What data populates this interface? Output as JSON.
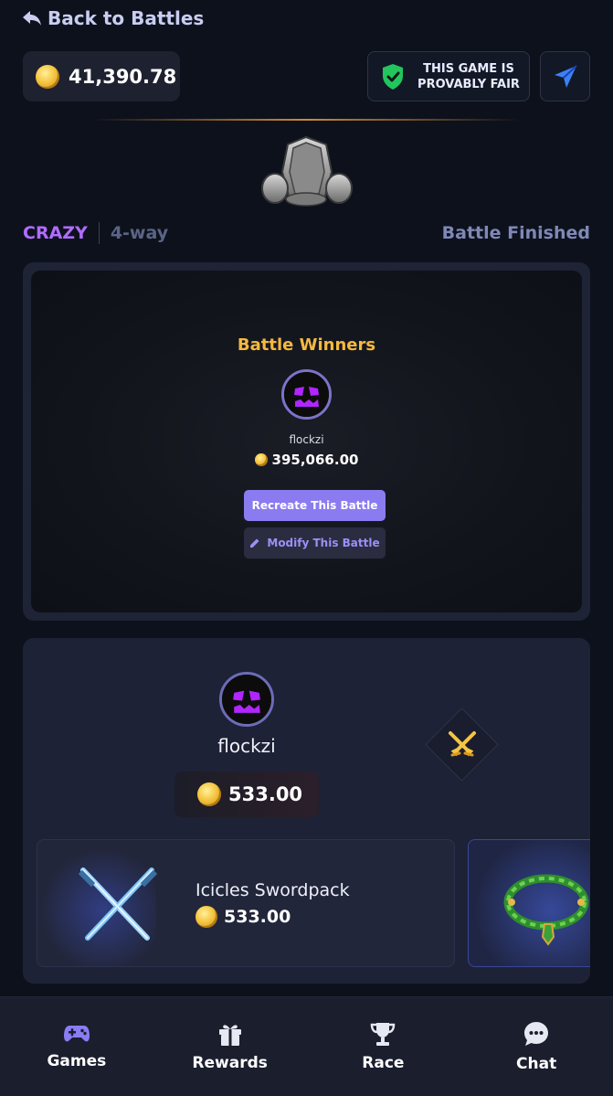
{
  "nav": {
    "back_label": "Back to Battles"
  },
  "header": {
    "balance": "41,390.78",
    "fair_label": "THIS GAME IS PROVABLY FAIR"
  },
  "battle": {
    "mode": "CRAZY",
    "ways": "4-way",
    "status": "Battle Finished"
  },
  "winners": {
    "title": "Battle Winners",
    "name": "flockzi",
    "amount": "395,066.00",
    "recreate_label": "Recreate This Battle",
    "modify_label": "Modify This Battle"
  },
  "player": {
    "name": "flockzi",
    "total": "533.00",
    "items": [
      {
        "name": "Icicles Swordpack",
        "price": "533.00"
      }
    ]
  },
  "bottom_nav": [
    {
      "label": "Games",
      "icon": "gamepad-icon"
    },
    {
      "label": "Rewards",
      "icon": "gift-icon"
    },
    {
      "label": "Race",
      "icon": "trophy-icon"
    },
    {
      "label": "Chat",
      "icon": "chat-icon"
    }
  ],
  "colors": {
    "accent_purple": "#8b7bf0",
    "mode_purple": "#b06cff",
    "gold": "#f4b93e",
    "background": "#0d111c"
  }
}
